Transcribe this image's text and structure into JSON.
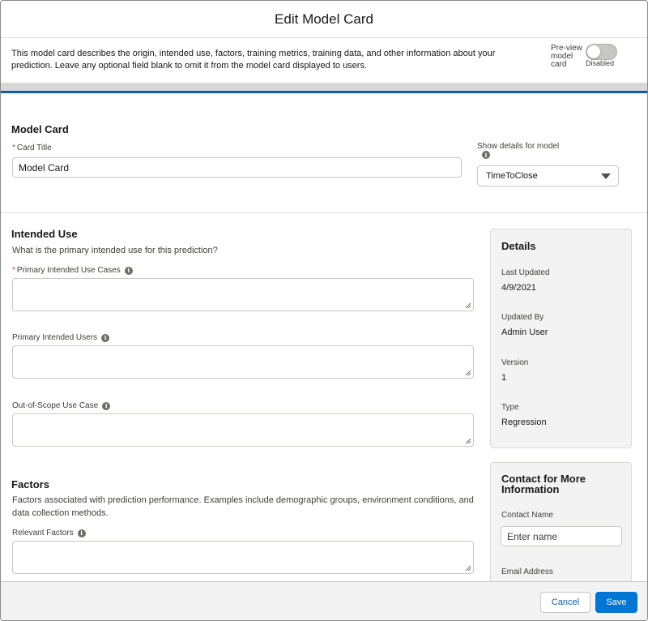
{
  "header": {
    "title": "Edit Model Card"
  },
  "intro": {
    "text": "This model card describes the origin, intended use, factors, training metrics, training data, and other information about your prediction. Leave any optional field blank to omit it from the model card displayed to users.",
    "preview_label": "Pre-view model card",
    "toggle_status": "Disabled"
  },
  "model_card": {
    "section_title": "Model Card",
    "card_title_label": "Card Title",
    "card_title_value": "Model Card",
    "show_details_label": "Show details for model",
    "model_select_value": "TimeToClose"
  },
  "intended_use": {
    "section_title": "Intended Use",
    "description": "What is the primary intended use for this prediction?",
    "use_cases_label": "Primary Intended Use Cases",
    "users_label": "Primary Intended Users",
    "out_of_scope_label": "Out-of-Scope Use Case"
  },
  "factors": {
    "section_title": "Factors",
    "description": "Factors associated with prediction performance. Examples include demographic groups, environment conditions, and data collection methods.",
    "relevant_factors_label": "Relevant Factors"
  },
  "details_panel": {
    "title": "Details",
    "last_updated_label": "Last Updated",
    "last_updated_value": "4/9/2021",
    "updated_by_label": "Updated By",
    "updated_by_value": "Admin User",
    "version_label": "Version",
    "version_value": "1",
    "type_label": "Type",
    "type_value": "Regression"
  },
  "contact_panel": {
    "title": "Contact for More Information",
    "contact_name_label": "Contact Name",
    "contact_name_placeholder": "Enter name",
    "email_label": "Email Address"
  },
  "footer": {
    "cancel_label": "Cancel",
    "save_label": "Save"
  },
  "colors": {
    "brand_blue": "#0176d3",
    "accent_line": "#0b5cab",
    "required_red": "#c23934"
  },
  "icons": [
    "info-icon",
    "chevron-down-icon",
    "resize-grip-icon"
  ]
}
